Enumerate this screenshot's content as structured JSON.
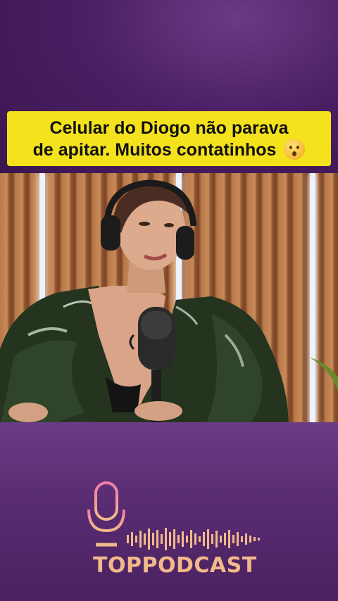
{
  "caption": {
    "line1": "Celular do Diogo não parava",
    "line2": "de apitar. Muitos contatinhos",
    "emoji": "hushed-face-emoji"
  },
  "video": {
    "description_icon": "podcast-video-frame"
  },
  "branding": {
    "name": "TOPPODCAST",
    "logo_icon": "microphone-icon",
    "wave_icon": "soundwave-icon"
  },
  "colors": {
    "caption_bg": "#f4e21c",
    "brand": "#f2b98a",
    "background": "#4a1f5e"
  }
}
